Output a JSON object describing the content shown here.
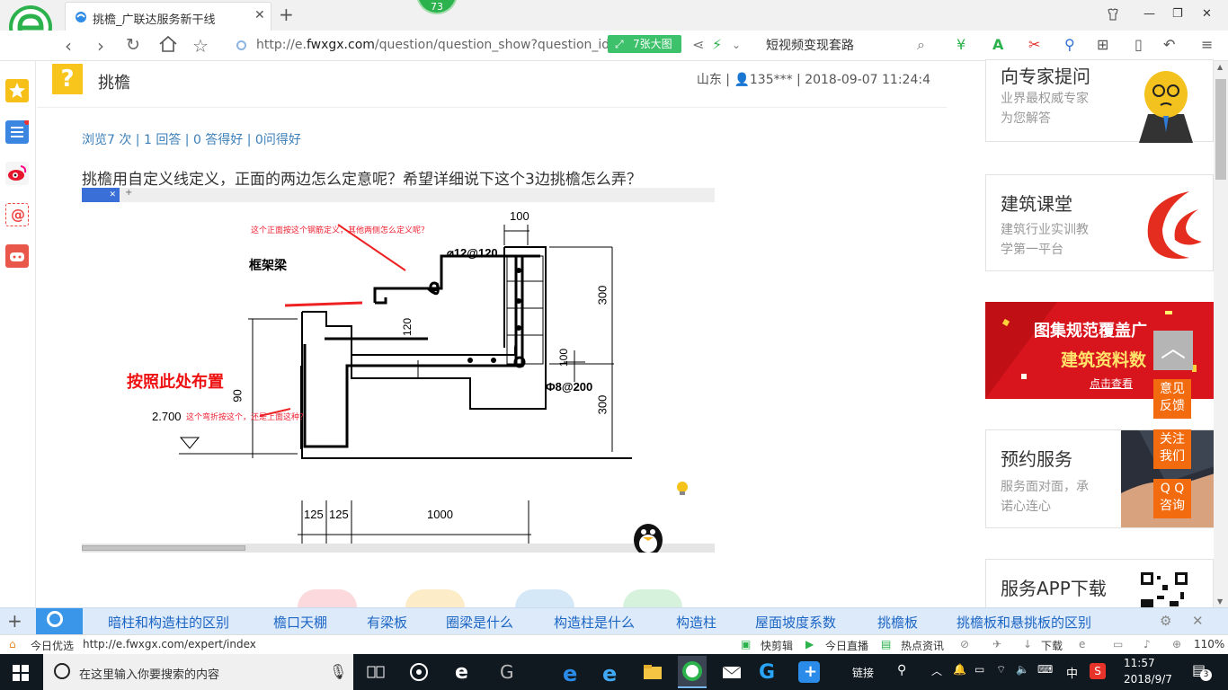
{
  "browser": {
    "tab_title": "挑檐_广联达服务新干线",
    "badge_count": "73",
    "url_prefix": "http://e.",
    "url_domain": "fwxgx.com",
    "url_path": "/question/question_show?question_id",
    "image_button": "7张大图",
    "search_query": "短视频变现套路"
  },
  "question": {
    "title": "挑檐",
    "meta": "山东 | 👤135*** | 2018-09-07 11:24:4",
    "stats": "浏览7 次 | 1 回答 | 0 答得好 | 0问得好",
    "text": "挑檐用自定义线定义，正面的两边怎么定意呢？希望详细说下这个3边挑檐怎么弄？"
  },
  "drawing": {
    "label_kuangjialiang": "框架梁",
    "label_rebar_top": "⌀12@120",
    "label_rebar_side": "Φ8@200",
    "dim_100_top": "100",
    "dim_300_a": "300",
    "dim_300_b": "300",
    "dim_120": "120",
    "dim_100_mid": "100",
    "dim_90": "90",
    "elevation": "2.700",
    "dim_125_a": "125",
    "dim_125_b": "125",
    "dim_1000": "1000",
    "note_red_large": "按照此处布置",
    "note_red_top": "这个正面按这个钢筋定义，其他两侧怎么定义呢？",
    "note_red_bottom": "这个弯折按这个，还是上面这种？"
  },
  "right_sidebar": {
    "card1_title": "向专家提问",
    "card1_sub1": "业界最权威专家",
    "card1_sub2": "为您解答",
    "card2_title": "建筑课堂",
    "card2_sub1": "建筑行业实训教",
    "card2_sub2": "学第一平台",
    "banner_line1": "图集规范覆盖广",
    "banner_line2": "建筑资料数",
    "banner_link": "点击查看",
    "card3_title": "预约服务",
    "card3_sub1": "服务面对面，承",
    "card3_sub2": "诺心连心",
    "card4_title": "服务APP下载",
    "float_feedback_1": "意见",
    "float_feedback_2": "反馈",
    "float_follow_1": "关注",
    "float_follow_2": "我们",
    "float_qq_1": "Q Q",
    "float_qq_2": "咨询"
  },
  "tag_bar": [
    "暗柱和构造柱的区别",
    "檐口天棚",
    "有梁板",
    "圈梁是什么",
    "构造柱是什么",
    "构造柱",
    "屋面坡度系数",
    "挑檐板",
    "挑檐板和悬挑板的区别"
  ],
  "status_bar": {
    "left_label": "今日优选",
    "hover_url": "http://e.fwxgx.com/expert/index",
    "kuaijian": "快剪辑",
    "zhibo": "今日直播",
    "zixun": "热点资讯",
    "download": "下载",
    "zoom": "110%"
  },
  "taskbar": {
    "search_placeholder": "在这里输入你要搜索的内容",
    "link_label": "链接",
    "ime": "中",
    "time": "11:57",
    "date": "2018/9/7",
    "notif_count": "3"
  },
  "colors": {
    "accent_blue": "#3a96e8",
    "link_blue": "#3c7fb8",
    "orange_float": "#f26c0f",
    "banner_red": "#d8151d",
    "question_yellow": "#f7c51c"
  }
}
